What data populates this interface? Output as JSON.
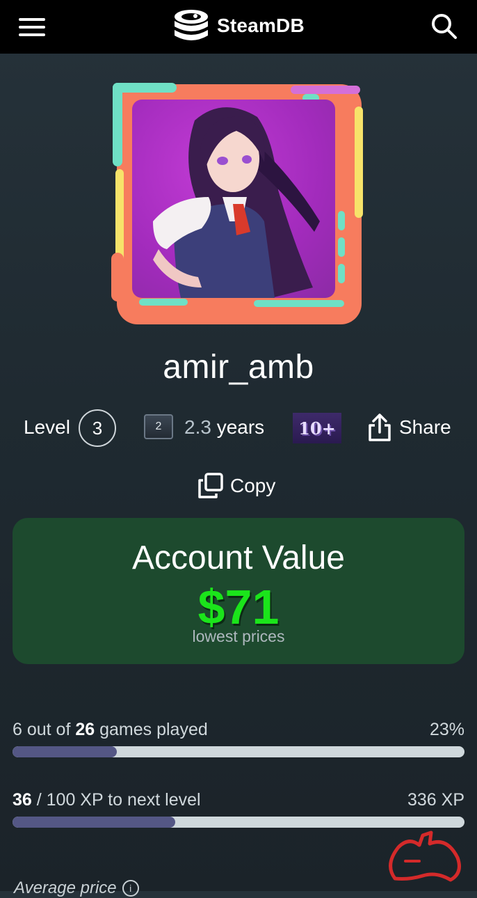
{
  "header": {
    "brand": "SteamDB",
    "menu_icon": "hamburger-menu-icon",
    "search_icon": "search-icon",
    "logo_icon": "steamdb-logo-icon"
  },
  "profile": {
    "username": "amir_amb",
    "level_label": "Level",
    "level_value": "3",
    "years_badge_value": "2",
    "years_number": "2.3",
    "years_unit": " years",
    "games_badge": "10+",
    "share_label": "Share",
    "copy_label": "Copy"
  },
  "account_value": {
    "title": "Account Value",
    "amount": "$71",
    "subtitle": "lowest prices",
    "accent_color": "#1be41b"
  },
  "games_progress": {
    "played": "6",
    "text_mid": " out of ",
    "total": "26",
    "text_end": " games played",
    "percent_label": "23%",
    "fraction": 0.23
  },
  "xp_progress": {
    "current": "36",
    "text_end": " / 100 XP to next level",
    "total_xp_label": "336 XP",
    "fraction": 0.36
  },
  "average_price": {
    "label": "Average price"
  }
}
